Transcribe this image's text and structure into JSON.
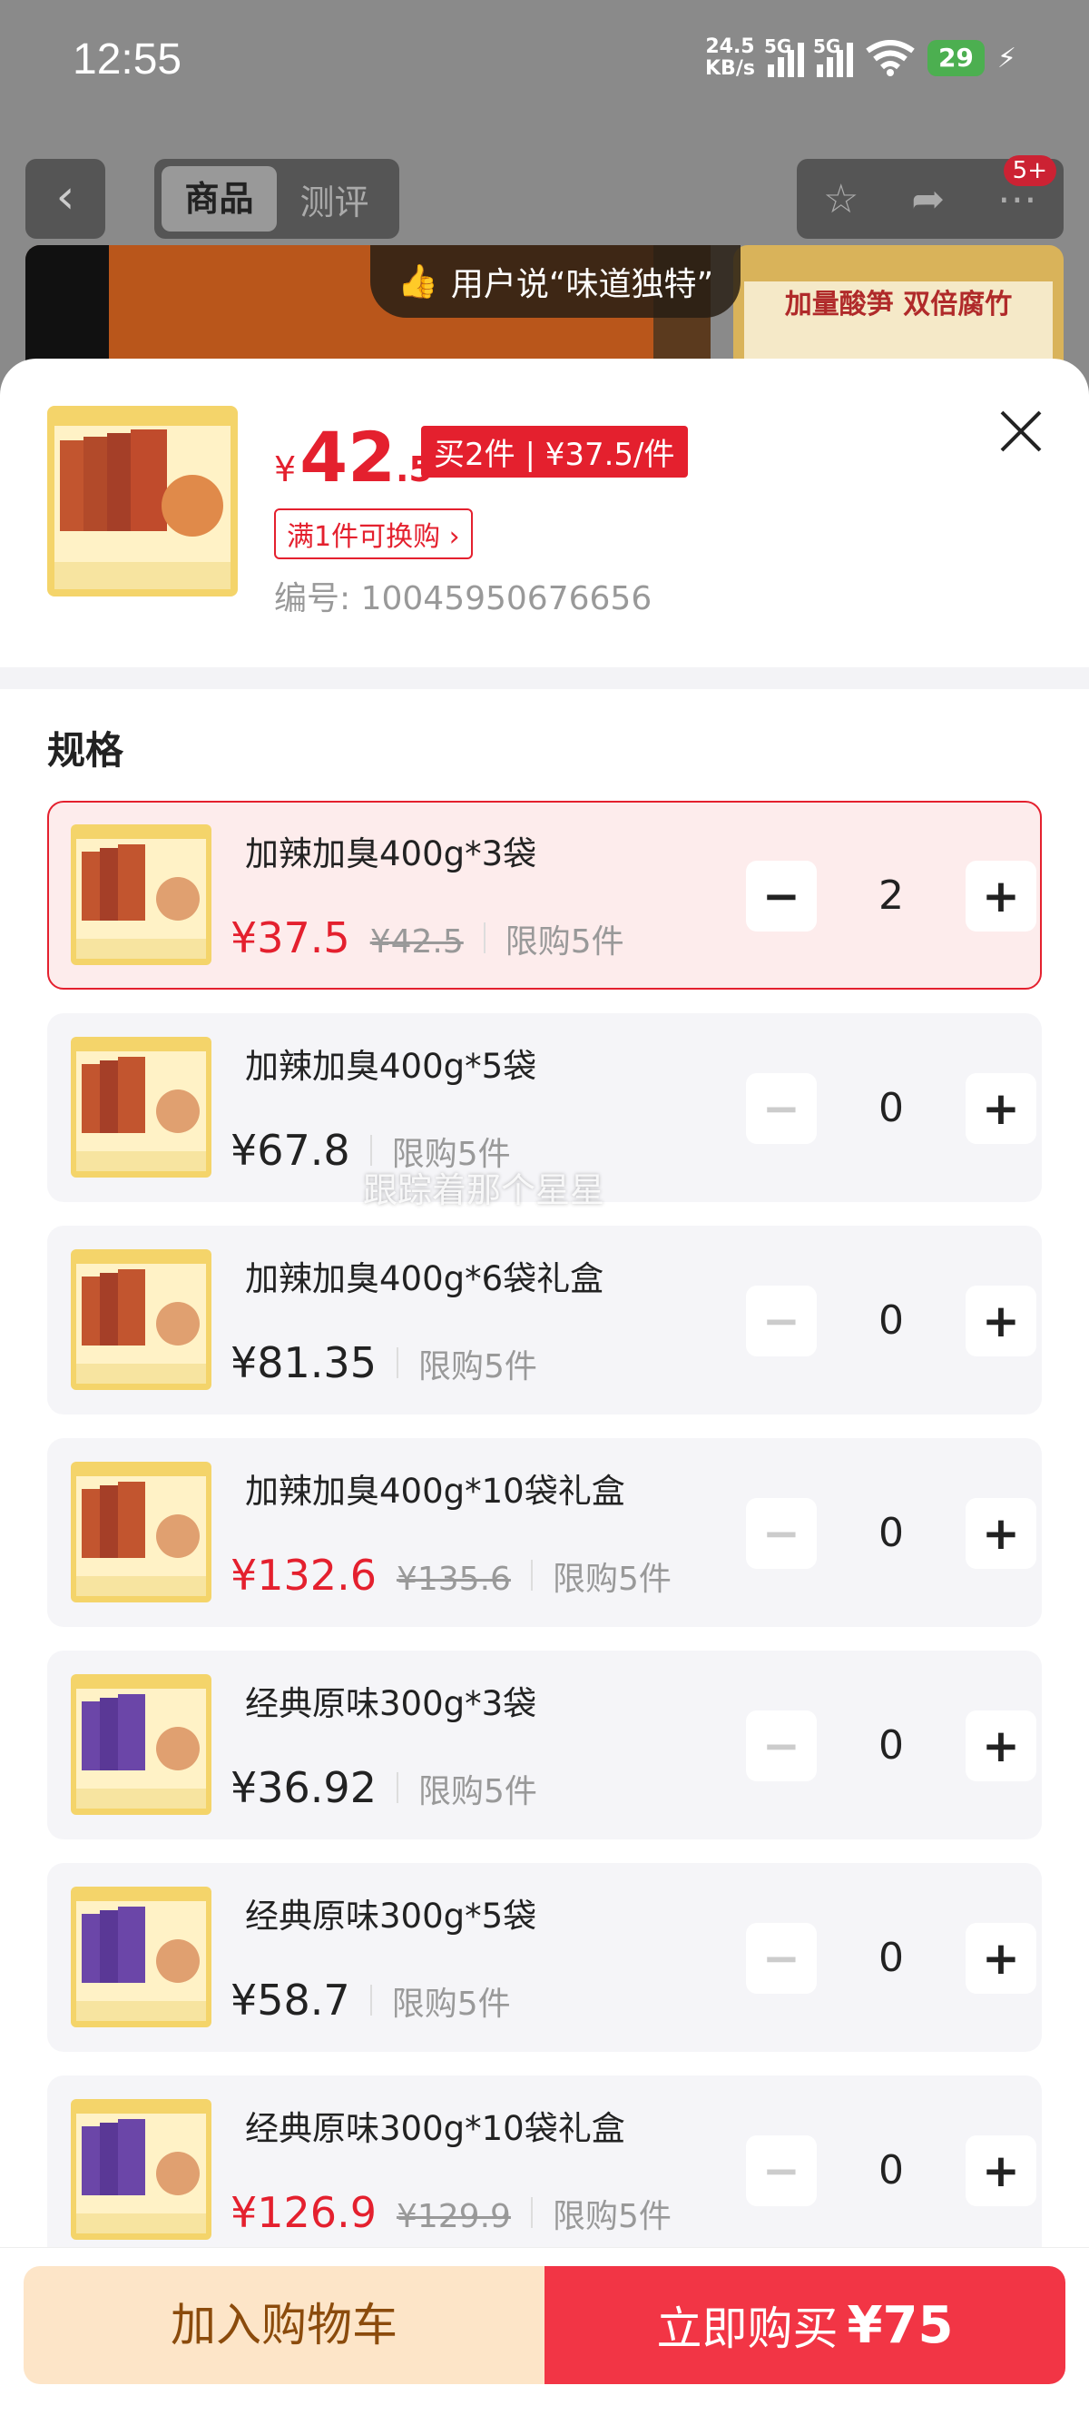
{
  "status_bar": {
    "time": "12:55",
    "net_speed_value": "24.5",
    "net_speed_unit": "KB/s",
    "sig1": "5G",
    "sig2": "5G",
    "battery": "29"
  },
  "nav": {
    "tabs": [
      "商品",
      "测评"
    ],
    "badge": "5+"
  },
  "banner": {
    "ribbon_text": "用户说“味道独特”",
    "right_text": "加量酸笋 双倍腐竹"
  },
  "header": {
    "price_currency": "¥",
    "price_int": "42",
    "price_dec": ".5",
    "promo": "买2件 | ¥37.5/件",
    "swap": "满1件可换购",
    "swap_arrow": "›",
    "sku_no": "编号: 10045950676656"
  },
  "spec": {
    "title": "规格",
    "options": [
      {
        "name": "加辣加臭400g*3袋",
        "price": "¥37.5",
        "orig": "¥42.5",
        "limit": "限购5件",
        "qty": "2",
        "discount": true,
        "selected": true
      },
      {
        "name": "加辣加臭400g*5袋",
        "price": "¥67.8",
        "orig": "",
        "limit": "限购5件",
        "qty": "0",
        "discount": false,
        "selected": false
      },
      {
        "name": "加辣加臭400g*6袋礼盒",
        "price": "¥81.35",
        "orig": "",
        "limit": "限购5件",
        "qty": "0",
        "discount": false,
        "selected": false
      },
      {
        "name": "加辣加臭400g*10袋礼盒",
        "price": "¥132.6",
        "orig": "¥135.6",
        "limit": "限购5件",
        "qty": "0",
        "discount": true,
        "selected": false
      },
      {
        "name": "经典原味300g*3袋",
        "price": "¥36.92",
        "orig": "",
        "limit": "限购5件",
        "qty": "0",
        "discount": false,
        "selected": false
      },
      {
        "name": "经典原味300g*5袋",
        "price": "¥58.7",
        "orig": "",
        "limit": "限购5件",
        "qty": "0",
        "discount": false,
        "selected": false
      },
      {
        "name": "经典原味300g*10袋礼盒",
        "price": "¥126.9",
        "orig": "¥129.9",
        "limit": "限购5件",
        "qty": "0",
        "discount": true,
        "selected": false
      }
    ]
  },
  "watermark": "跟踪着那个星星",
  "bottom": {
    "cart_label": "加入购物车",
    "buy_label": "立即购买",
    "buy_amount": "¥75"
  },
  "colors": {
    "accent": "#e4202e",
    "cart_bg": "#fde5c8",
    "buy_bg": "#f23545"
  },
  "icons": [
    "back-icon",
    "star-icon",
    "share-icon",
    "more-icon",
    "thumb-up-icon",
    "close-icon",
    "minus-icon",
    "plus-icon"
  ]
}
